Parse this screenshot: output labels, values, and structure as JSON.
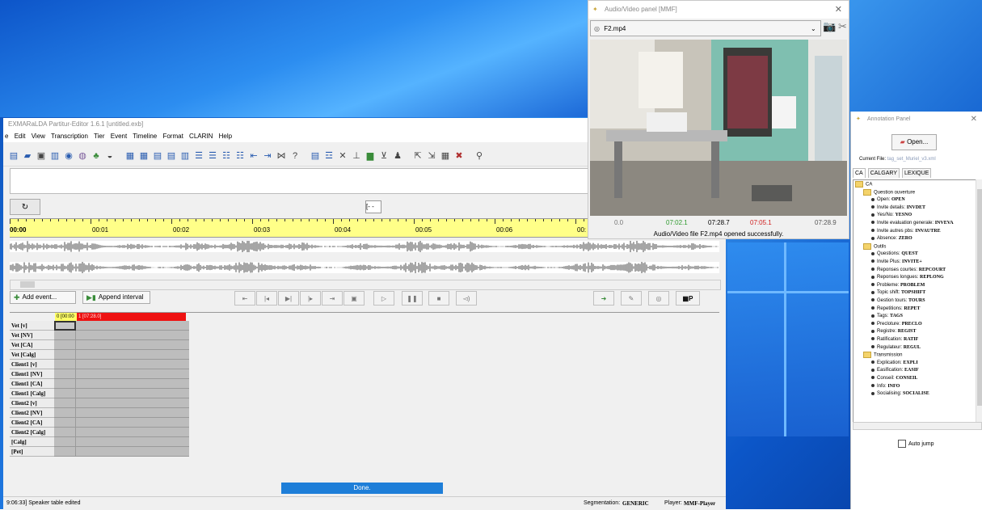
{
  "editor": {
    "title": "EXMARaLDA Partitur-Editor 1.6.1 [untitled.exb]",
    "menu": [
      "e",
      "Edit",
      "View",
      "Transcription",
      "Tier",
      "Event",
      "Timeline",
      "Format",
      "CLARIN",
      "Help"
    ],
    "position_field": "[- -",
    "timeline_ticks": [
      "00:00",
      "00:01",
      "00:02",
      "00:03",
      "00:04",
      "00:05",
      "00:06",
      "00:"
    ],
    "add_event_label": "Add event...",
    "append_interval_label": "Append interval",
    "grid_header": [
      "0 [00:00",
      "1 [07:28.0]"
    ],
    "tiers": [
      "Vet [v]",
      "Vet [NV]",
      "Vet [CA]",
      "Vet [Calg]",
      "Client1 [v]",
      "Client1 [NV]",
      "Client1 [CA]",
      "Client1 [Calg]",
      "Client2 [v]",
      "Client2 [NV]",
      "Client2 [CA]",
      "Client2 [Calg]",
      "[Calg]",
      "[Pet]"
    ],
    "progress_text": "Done.",
    "status_left": "9:06:33] Speaker table edited",
    "status_segmentation_label": "Segmentation:",
    "status_segmentation_value": "GENERIC",
    "status_player_label": "Player:",
    "status_player_value": "MMF-Player"
  },
  "av_panel": {
    "title": "Audio/Video panel [MMF]",
    "file": "F2.mp4",
    "times": [
      {
        "text": "0.0",
        "color": "#777777"
      },
      {
        "text": "07:02.1",
        "color": "#2e9a2e"
      },
      {
        "text": "07:28.7",
        "color": "#000000"
      },
      {
        "text": "07:05.1",
        "color": "#d02020"
      },
      {
        "text": "07:28.9",
        "color": "#555555"
      }
    ],
    "message": "Audio/Video file F2.mp4 opened successfully."
  },
  "annotation_panel": {
    "title": "Annotation Panel",
    "open_label": "Open...",
    "current_file_label": "Current File:",
    "current_file": "tag_set_Muriel_v3.xml",
    "tabs": [
      "CA",
      "CALGARY",
      "LEXIQUE"
    ],
    "tree": [
      {
        "level": 0,
        "type": "root",
        "text": "CA"
      },
      {
        "level": 1,
        "type": "folder",
        "text": "Question ouverture"
      },
      {
        "level": 2,
        "type": "item",
        "label": "Open: ",
        "code": "OPEN"
      },
      {
        "level": 2,
        "type": "item",
        "label": "Invite details: ",
        "code": "INVDET"
      },
      {
        "level": 2,
        "type": "item",
        "label": "Yes/No: ",
        "code": "YESNO"
      },
      {
        "level": 2,
        "type": "item",
        "label": "Invite evaluation generale: ",
        "code": "INVEVA"
      },
      {
        "level": 2,
        "type": "item",
        "label": "Invite autres pbs: ",
        "code": "INVAUTRE"
      },
      {
        "level": 2,
        "type": "item",
        "label": "Absence: ",
        "code": "ZERO"
      },
      {
        "level": 1,
        "type": "folder",
        "text": "Outils"
      },
      {
        "level": 2,
        "type": "item",
        "label": "Questions: ",
        "code": "QUEST"
      },
      {
        "level": 2,
        "type": "item",
        "label": "Invite Plus: ",
        "code": "INVITE+"
      },
      {
        "level": 2,
        "type": "item",
        "label": "Reponses courtes: ",
        "code": "REPCOURT"
      },
      {
        "level": 2,
        "type": "item",
        "label": "Reponses longues: ",
        "code": "REPLONG"
      },
      {
        "level": 2,
        "type": "item",
        "label": "Probleme: ",
        "code": "PROBLEM"
      },
      {
        "level": 2,
        "type": "item",
        "label": "Topic shift: ",
        "code": "TOPSHIFT"
      },
      {
        "level": 2,
        "type": "item",
        "label": "Gestion tours: ",
        "code": "TOURS"
      },
      {
        "level": 2,
        "type": "item",
        "label": "Repetitions: ",
        "code": "REPET"
      },
      {
        "level": 2,
        "type": "item",
        "label": "Tags: ",
        "code": "TAGS"
      },
      {
        "level": 2,
        "type": "item",
        "label": "Precloture: ",
        "code": "PRECLO"
      },
      {
        "level": 2,
        "type": "item",
        "label": "Registre: ",
        "code": "REGIST"
      },
      {
        "level": 2,
        "type": "item",
        "label": "Ratification: ",
        "code": "RATIF"
      },
      {
        "level": 2,
        "type": "item",
        "label": "Regulateur: ",
        "code": "REGUL"
      },
      {
        "level": 1,
        "type": "folder",
        "text": "Transmission"
      },
      {
        "level": 2,
        "type": "item",
        "label": "Explication: ",
        "code": "EXPLI"
      },
      {
        "level": 2,
        "type": "item",
        "label": "Easification: ",
        "code": "EASIF"
      },
      {
        "level": 2,
        "type": "item",
        "label": "Conseil: ",
        "code": "CONSEIL"
      },
      {
        "level": 2,
        "type": "item",
        "label": "Info: ",
        "code": "INFO"
      },
      {
        "level": 2,
        "type": "item",
        "label": "Socialising: ",
        "code": "SOCIALISE"
      }
    ],
    "auto_jump_label": "Auto jump"
  }
}
